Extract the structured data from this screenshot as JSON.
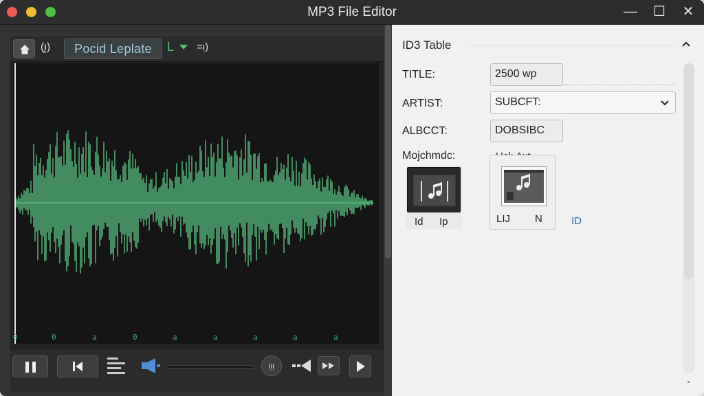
{
  "window": {
    "title": "MP3 File Editor",
    "controls": {
      "minimize": "—",
      "maximize": "☐",
      "close": "✕"
    }
  },
  "player": {
    "toolbar": {
      "home_icon": "home-icon",
      "rec_label": "(̧ᴉ)",
      "preset_label": "Pocid  Leplate",
      "channel_label": "L",
      "volume_label": "=ᴉ)"
    },
    "timeline_ticks": [
      "0",
      "0",
      "a",
      "0",
      "a",
      "a",
      "a",
      "a",
      "a"
    ],
    "transport": {
      "round_label": "ᴉᴉᴉ"
    },
    "colors": {
      "waveform": "#4faa72",
      "background": "#141514"
    }
  },
  "id3": {
    "title": "ID3 Table",
    "title_field": {
      "label": "TITLE:",
      "value": "2500 wp"
    },
    "artist_field": {
      "label": "ARTIST:",
      "value": "SUBCFT:"
    },
    "album_field": {
      "label": "ALBCCT:",
      "value": "DOBSIBC"
    },
    "art_section": {
      "label": "Mojchmdc:"
    },
    "art1": {
      "caption_left": "Id",
      "caption_right": "Ip"
    },
    "art2": {
      "title": "Ucl:  Axt",
      "caption_left": "LIJ",
      "caption_right": "N"
    },
    "link_label": "ID"
  }
}
